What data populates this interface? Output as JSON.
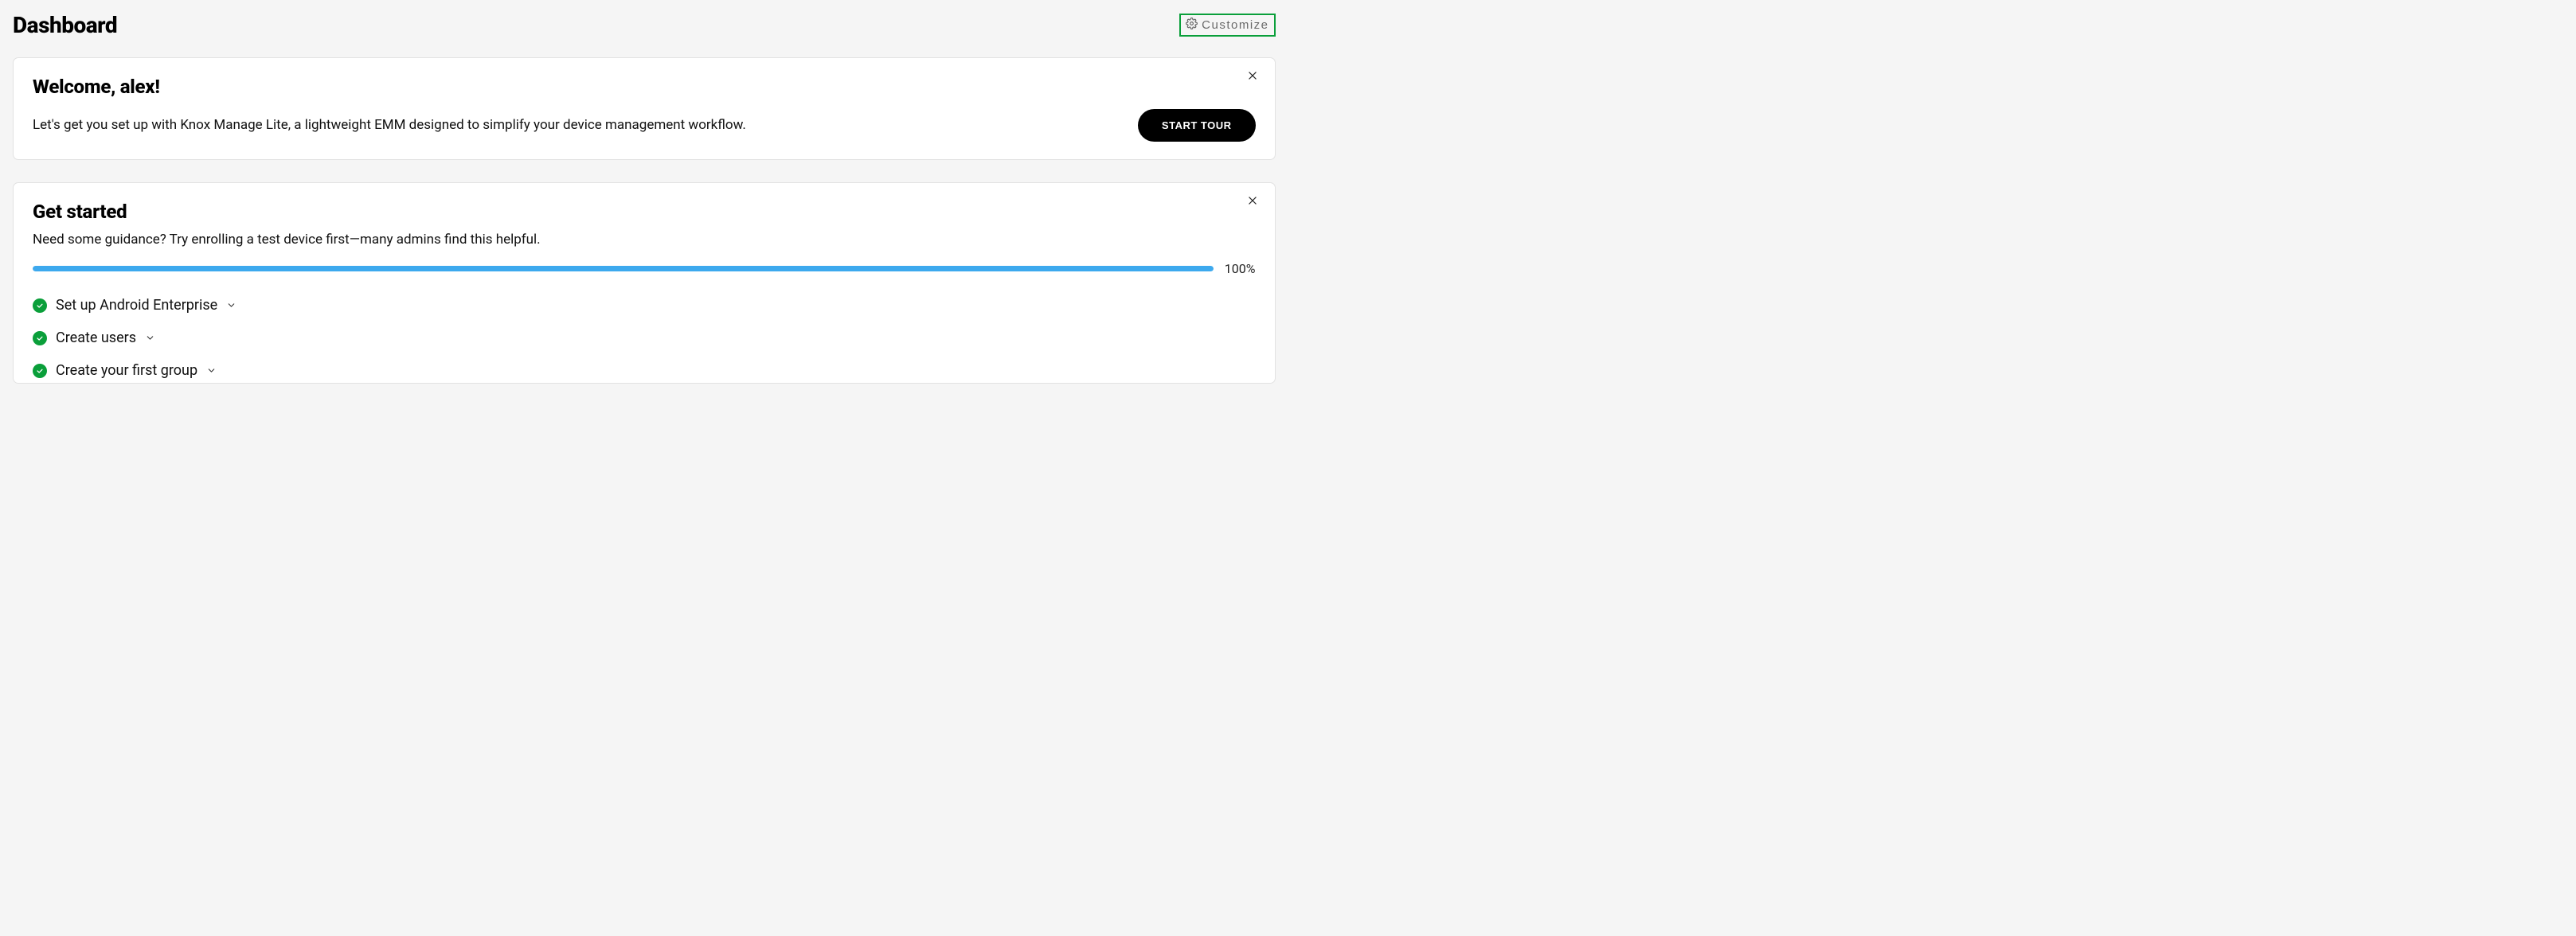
{
  "header": {
    "title": "Dashboard",
    "customize_label": "Customize"
  },
  "welcome": {
    "title": "Welcome, alex!",
    "description": "Let's get you set up with Knox Manage Lite, a lightweight EMM designed to simplify your device management workflow.",
    "start_tour_label": "START TOUR"
  },
  "get_started": {
    "title": "Get started",
    "description": "Need some guidance? Try enrolling a test device first—many admins find this helpful.",
    "progress_percent": "100%",
    "steps": [
      {
        "label": "Set up Android Enterprise"
      },
      {
        "label": "Create users"
      },
      {
        "label": "Create your first group"
      }
    ]
  }
}
